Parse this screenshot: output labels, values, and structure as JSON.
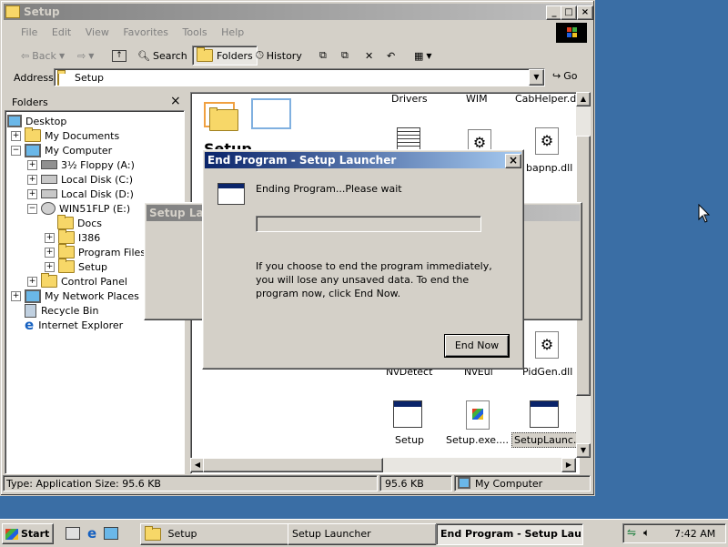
{
  "explorer": {
    "title": "Setup",
    "menu": [
      "File",
      "Edit",
      "View",
      "Favorites",
      "Tools",
      "Help"
    ],
    "toolbar": {
      "back": "Back",
      "search": "Search",
      "folders": "Folders",
      "history": "History"
    },
    "address_label": "Address",
    "address_value": "Setup",
    "go_label": "Go",
    "folders_pane_title": "Folders",
    "tree": [
      {
        "label": "Desktop"
      },
      {
        "label": "My Documents"
      },
      {
        "label": "My Computer"
      },
      {
        "label": "3½ Floppy (A:)"
      },
      {
        "label": "Local Disk (C:)"
      },
      {
        "label": "Local Disk (D:)"
      },
      {
        "label": "WIN51FLP (E:)"
      },
      {
        "label": "Docs"
      },
      {
        "label": "I386"
      },
      {
        "label": "Program Files"
      },
      {
        "label": "Setup"
      },
      {
        "label": "Control Panel"
      },
      {
        "label": "My Network Places"
      },
      {
        "label": "Recycle Bin"
      },
      {
        "label": "Internet Explorer"
      }
    ],
    "folder_header": "Setup",
    "files_row1": [
      "Drivers",
      "WIM",
      "CabHelper.dll"
    ],
    "files_partial": [
      "bapnp.dll",
      "NvDetect",
      "NvEul",
      "PidGen.dll"
    ],
    "files_last": [
      "Setup",
      "Setup.exe....",
      "SetupLaunc..."
    ],
    "status": {
      "left": "Type: Application Size: 95.6 KB",
      "size": "95.6 KB",
      "zone": "My Computer"
    }
  },
  "background_dialog": {
    "title": "Setup Launc"
  },
  "dialog": {
    "title": "End Program - Setup Launcher",
    "message": "Ending Program...Please wait",
    "progress": 0,
    "info": "If you choose to end the program immediately, you will lose any unsaved data. To end the program now, click End Now.",
    "end_now": "End Now",
    "close": "×"
  },
  "taskbar": {
    "start": "Start",
    "tasks": [
      "Setup",
      "Setup Launcher",
      "End Program - Setup Lau..."
    ],
    "clock": "7:42 AM"
  },
  "colors": {
    "desktop": "#3a6ea5",
    "title_active": "#0a246a",
    "title_inactive": "#808080",
    "face": "#d4d0c8"
  }
}
